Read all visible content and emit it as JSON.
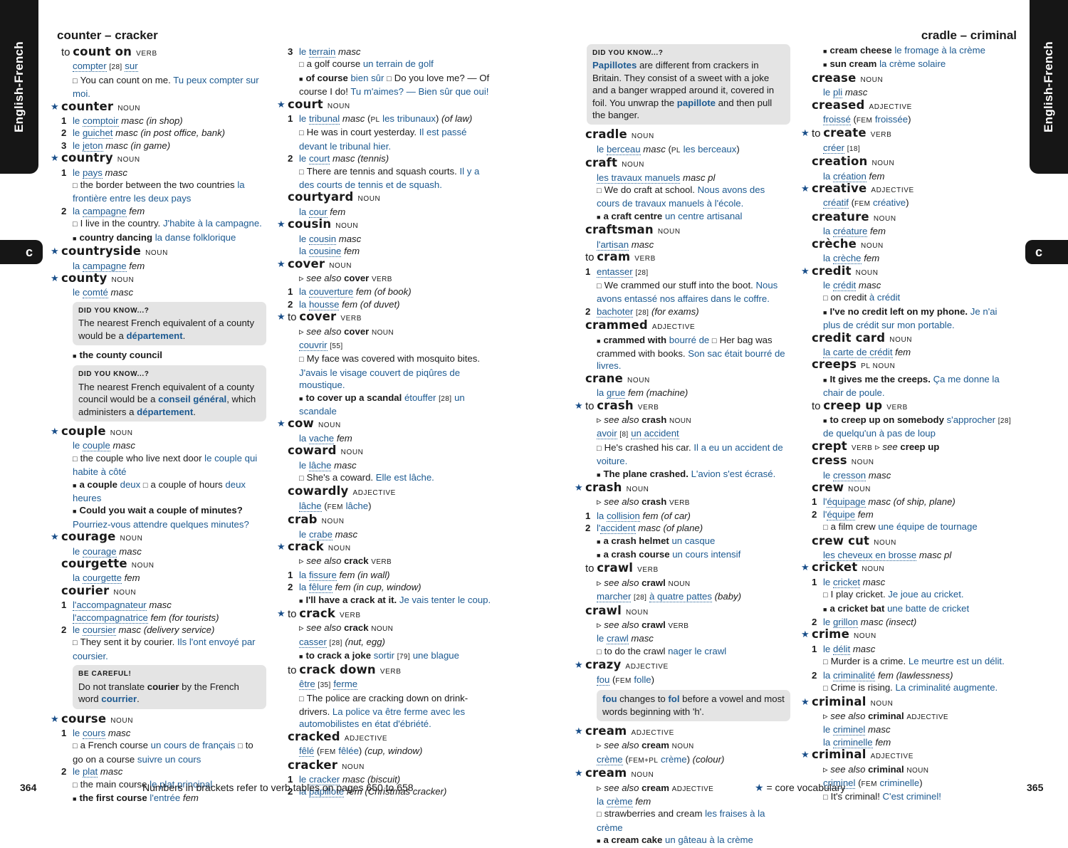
{
  "tabs": {
    "language": "English-French",
    "letter": "c"
  },
  "running_heads": {
    "left": "counter – cracker",
    "right": "cradle – criminal"
  },
  "footer": {
    "left_page_number": "364",
    "left_note": "Numbers in brackets refer to verb tables on pages 650 to 658",
    "right_note": "= core vocabulary",
    "right_note_symbol": "★",
    "right_page_number": "365"
  },
  "col1": {
    "e1": {
      "to": "to",
      "hw": "count on",
      "pos": "verb",
      "t1": "compter",
      "n1": "[28]",
      "t2": "sur",
      "ex_en": "You can count on me.",
      "ex_fr": "Tu peux compter sur moi."
    },
    "e2": {
      "hw": "counter",
      "pos": "noun",
      "s1": {
        "art": "le",
        "w": "comptoir",
        "g": "masc",
        "c": "(in shop)"
      },
      "s2": {
        "art": "le",
        "w": "guichet",
        "g": "masc",
        "c": "(in post office, bank)"
      },
      "s3": {
        "art": "le",
        "w": "jeton",
        "g": "masc",
        "c": "(in game)"
      }
    },
    "e3": {
      "hw": "country",
      "pos": "noun",
      "s1": {
        "art": "le",
        "w": "pays",
        "g": "masc",
        "ex_en": "the border between the two countries",
        "ex_fr": "la frontière entre les deux pays"
      },
      "s2": {
        "art": "la",
        "w": "campagne",
        "g": "fem",
        "ex_en": "I live in the country.",
        "ex_fr": "J'habite à la campagne.",
        "ph_en": "country dancing",
        "ph_fr": "la danse folklorique"
      }
    },
    "e4": {
      "hw": "countryside",
      "pos": "noun",
      "art": "la",
      "w": "campagne",
      "g": "fem"
    },
    "e5": {
      "hw": "county",
      "pos": "noun",
      "art": "le",
      "w": "comté",
      "g": "masc",
      "box1": {
        "label": "Did you know...?",
        "t1": "The nearest French equivalent of a county would be a ",
        "b1": "département",
        "t2": "."
      },
      "ph": "the county council",
      "box2": {
        "label": "Did you know...?",
        "t1": "The nearest French equivalent of a county council would be a ",
        "b1": "conseil général",
        "t2": ", which administers a ",
        "b2": "département",
        "t3": "."
      }
    },
    "e6": {
      "hw": "couple",
      "pos": "noun",
      "art": "le",
      "w": "couple",
      "g": "masc",
      "ex1_en": "the couple who live next door",
      "ex1_fr": "le couple qui habite à côté",
      "ph1_en": "a couple",
      "ph1_fr": "deux",
      "ex2_en": "a couple of hours",
      "ex2_fr": "deux heures",
      "ph2_en": "Could you wait a couple of minutes?",
      "ph2_fr": "Pourriez-vous attendre quelques minutes?"
    },
    "e7": {
      "hw": "courage",
      "pos": "noun",
      "art": "le",
      "w": "courage",
      "g": "masc"
    },
    "e8": {
      "hw": "courgette",
      "pos": "noun",
      "art": "la",
      "w": "courgette",
      "g": "fem"
    },
    "e9": {
      "hw": "courier",
      "pos": "noun",
      "s1": {
        "w1": "l'accompagnateur",
        "g1": "masc",
        "w2": "l'accompagnatrice",
        "g2": "fem",
        "c": "(for tourists)"
      },
      "s2": {
        "art": "le",
        "w": "coursier",
        "g": "masc",
        "c": "(delivery service)",
        "ex_en": "They sent it by courier.",
        "ex_fr": "Ils l'ont envoyé par coursier."
      },
      "box": {
        "label": "Be careful!",
        "t1": "Do not translate ",
        "b1": "courier",
        "t2": " by the French word ",
        "b2": "courrier",
        "t3": "."
      }
    },
    "e10": {
      "hw": "course",
      "pos": "noun",
      "s1": {
        "art": "le",
        "w": "cours",
        "g": "masc",
        "ex1_en": "a French course",
        "ex1_fr": "un cours de français",
        "ex2_en": "to go on a course",
        "ex2_fr": "suivre un cours"
      },
      "s2": {
        "art": "le",
        "w": "plat",
        "g": "masc",
        "ex_en": "the main course",
        "ex_fr": "le plat principal",
        "ph_en": "the first course",
        "ph_fr": "l'entrée",
        "ph_g": "fem"
      }
    }
  },
  "col2": {
    "c1": {
      "art": "le",
      "w": "terrain",
      "g": "masc",
      "ex_en": "a golf course",
      "ex_fr": "un terrain de golf",
      "ph_en": "of course",
      "ph_fr": "bien sûr",
      "ex2_en": "Do you love me? — Of course I do!",
      "ex2_fr": "Tu m'aimes? — Bien sûr que oui!"
    },
    "e1": {
      "hw": "court",
      "pos": "noun",
      "s1": {
        "art": "le",
        "w": "tribunal",
        "g": "masc",
        "pl": "pl",
        "plw": "les tribunaux",
        "c": "(of law)",
        "ex_en": "He was in court yesterday.",
        "ex_fr": "Il est passé devant le tribunal hier."
      },
      "s2": {
        "art": "le",
        "w": "court",
        "g": "masc",
        "c": "(tennis)",
        "ex_en": "There are tennis and squash courts.",
        "ex_fr": "Il y a des courts de tennis et de squash."
      }
    },
    "e2": {
      "hw": "courtyard",
      "pos": "noun",
      "art": "la",
      "w": "cour",
      "g": "fem"
    },
    "e3": {
      "hw": "cousin",
      "pos": "noun",
      "a1": "le",
      "w1": "cousin",
      "g1": "masc",
      "a2": "la",
      "w2": "cousine",
      "g2": "fem"
    },
    "e4": {
      "hw": "cover",
      "pos": "noun",
      "see": "see also",
      "see_hw": "cover",
      "see_pos": "verb",
      "s1": {
        "art": "la",
        "w": "couverture",
        "g": "fem",
        "c": "(of book)"
      },
      "s2": {
        "art": "la",
        "w": "housse",
        "g": "fem",
        "c": "(of duvet)"
      }
    },
    "e5": {
      "to": "to",
      "hw": "cover",
      "pos": "verb",
      "see": "see also",
      "see_hw": "cover",
      "see_pos": "noun",
      "w": "couvrir",
      "n": "[55]",
      "ex_en": "My face was covered with mosquito bites.",
      "ex_fr": "J'avais le visage couvert de piqûres de moustique.",
      "ph_en": "to cover up a scandal",
      "ph_fr1": "étouffer",
      "ph_n": "[28]",
      "ph_fr2": "un scandale"
    },
    "e6": {
      "hw": "cow",
      "pos": "noun",
      "art": "la",
      "w": "vache",
      "g": "fem"
    },
    "e7": {
      "hw": "coward",
      "pos": "noun",
      "art": "le",
      "w": "lâche",
      "g": "masc",
      "ex_en": "She's a coward.",
      "ex_fr": "Elle est lâche."
    },
    "e8": {
      "hw": "cowardly",
      "pos": "adjective",
      "w": "lâche",
      "fem": "fem",
      "fw": "lâche"
    },
    "e9": {
      "hw": "crab",
      "pos": "noun",
      "art": "le",
      "w": "crabe",
      "g": "masc"
    },
    "e10": {
      "hw": "crack",
      "pos": "noun",
      "see": "see also",
      "see_hw": "crack",
      "see_pos": "verb",
      "s1": {
        "art": "la",
        "w": "fissure",
        "g": "fem",
        "c": "(in wall)"
      },
      "s2": {
        "art": "la",
        "w": "fêlure",
        "g": "fem",
        "c": "(in cup, window)",
        "ph_en": "I'll have a crack at it.",
        "ph_fr": "Je vais tenter le coup."
      }
    },
    "e11": {
      "to": "to",
      "hw": "crack",
      "pos": "verb",
      "see": "see also",
      "see_hw": "crack",
      "see_pos": "noun",
      "w": "casser",
      "n": "[28]",
      "c": "(nut, egg)",
      "ph_en": "to crack a joke",
      "ph_fr1": "sortir",
      "ph_n": "[79]",
      "ph_fr2": "une blague"
    },
    "e12": {
      "to": "to",
      "hw": "crack down",
      "pos": "verb",
      "w1": "être",
      "n": "[35]",
      "w2": "ferme",
      "ex_en": "The police are cracking down on drink-drivers.",
      "ex_fr": "La police va être ferme avec les automobilistes en état d'ébriété."
    },
    "e13": {
      "hw": "cracked",
      "pos": "adjective",
      "w": "fêlé",
      "fem": "fem",
      "fw": "fêlée",
      "c": "(cup, window)"
    },
    "e14": {
      "hw": "cracker",
      "pos": "noun",
      "s1": {
        "art": "le",
        "w": "cracker",
        "g": "masc",
        "c": "(biscuit)"
      },
      "s2": {
        "art": "la",
        "w": "papillote",
        "g": "fem",
        "c": "(Christmas cracker)"
      }
    }
  },
  "col3": {
    "box": {
      "label": "Did you know...?",
      "b1": "Papillotes",
      "t1": " are different from crackers in Britain. They consist of a sweet with a joke and a banger wrapped around it, covered in foil. You unwrap the ",
      "b2": "papillote",
      "t2": " and then pull the banger."
    },
    "e1": {
      "hw": "cradle",
      "pos": "noun",
      "art": "le",
      "w": "berceau",
      "g": "masc",
      "pl": "pl",
      "plw": "les berceaux"
    },
    "e2": {
      "hw": "craft",
      "pos": "noun",
      "w": "les travaux manuels",
      "g": "masc pl",
      "ex_en": "We do craft at school.",
      "ex_fr": "Nous avons des cours de travaux manuels à l'école.",
      "ph_en": "a craft centre",
      "ph_fr": "un centre artisanal"
    },
    "e3": {
      "hw": "craftsman",
      "pos": "noun",
      "w": "l'artisan",
      "g": "masc"
    },
    "e4": {
      "to": "to",
      "hw": "cram",
      "pos": "verb",
      "s1": {
        "w": "entasser",
        "n": "[28]",
        "ex_en": "We crammed our stuff into the boot.",
        "ex_fr": "Nous avons entassé nos affaires dans le coffre."
      },
      "s2": {
        "w": "bachoter",
        "n": "[28]",
        "c": "(for exams)"
      }
    },
    "e5": {
      "hw": "crammed",
      "pos": "adjective",
      "ph_en": "crammed with",
      "ph_fr": "bourré de",
      "ex_en": "Her bag was crammed with books.",
      "ex_fr": "Son sac était bourré de livres."
    },
    "e6": {
      "hw": "crane",
      "pos": "noun",
      "art": "la",
      "w": "grue",
      "g": "fem",
      "c": "(machine)"
    },
    "e7": {
      "to": "to",
      "hw": "crash",
      "pos": "verb",
      "see": "see also",
      "see_hw": "crash",
      "see_pos": "noun",
      "w1": "avoir",
      "n": "[8]",
      "w2": "un accident",
      "ex_en": "He's crashed his car.",
      "ex_fr": "Il a eu un accident de voiture.",
      "ph_en": "The plane crashed.",
      "ph_fr": "L'avion s'est écrasé."
    },
    "e8": {
      "hw": "crash",
      "pos": "noun",
      "see": "see also",
      "see_hw": "crash",
      "see_pos": "verb",
      "s1": {
        "art": "la",
        "w": "collision",
        "g": "fem",
        "c": "(of car)"
      },
      "s2": {
        "art": "l'",
        "w": "accident",
        "g": "masc",
        "c": "(of plane)",
        "ph1_en": "a crash helmet",
        "ph1_fr": "un casque",
        "ph2_en": "a crash course",
        "ph2_fr": "un cours intensif"
      }
    },
    "e9": {
      "to": "to",
      "hw": "crawl",
      "pos": "verb",
      "see": "see also",
      "see_hw": "crawl",
      "see_pos": "noun",
      "w1": "marcher",
      "n": "[28]",
      "w2": "à quatre pattes",
      "c": "(baby)"
    },
    "e10": {
      "hw": "crawl",
      "pos": "noun",
      "see": "see also",
      "see_hw": "crawl",
      "see_pos": "verb",
      "art": "le",
      "w": "crawl",
      "g": "masc",
      "ex_en": "to do the crawl",
      "ex_fr": "nager le crawl"
    },
    "e11": {
      "hw": "crazy",
      "pos": "adjective",
      "w": "fou",
      "fem": "fem",
      "fw": "folle",
      "box": {
        "b1": "fou",
        "t1": " changes to ",
        "b2": "fol",
        "t2": " before a vowel and most words beginning with 'h'."
      }
    },
    "e12": {
      "hw": "cream",
      "pos": "adjective",
      "see": "see also",
      "see_hw": "cream",
      "see_pos": "noun",
      "w": "crème",
      "fem": "fem+pl",
      "fw": "crème",
      "c": "(colour)"
    },
    "e13": {
      "hw": "cream",
      "pos": "noun",
      "see": "see also",
      "see_hw": "cream",
      "see_pos": "adjective",
      "art": "la",
      "w": "crème",
      "g": "fem",
      "ex_en": "strawberries and cream",
      "ex_fr": "les fraises à la crème",
      "ph_en": "a cream cake",
      "ph_fr": "un gâteau à la crème"
    }
  },
  "col4": {
    "c1": {
      "ph1_en": "cream cheese",
      "ph1_fr": "le fromage à la crème",
      "ph2_en": "sun cream",
      "ph2_fr": "la crème solaire"
    },
    "e1": {
      "hw": "crease",
      "pos": "noun",
      "art": "le",
      "w": "pli",
      "g": "masc"
    },
    "e2": {
      "hw": "creased",
      "pos": "adjective",
      "w": "froissé",
      "fem": "fem",
      "fw": "froissée"
    },
    "e3": {
      "to": "to",
      "hw": "create",
      "pos": "verb",
      "w": "créer",
      "n": "[18]"
    },
    "e4": {
      "hw": "creation",
      "pos": "noun",
      "art": "la",
      "w": "création",
      "g": "fem"
    },
    "e5": {
      "hw": "creative",
      "pos": "adjective",
      "w": "créatif",
      "fem": "fem",
      "fw": "créative"
    },
    "e6": {
      "hw": "creature",
      "pos": "noun",
      "art": "la",
      "w": "créature",
      "g": "fem"
    },
    "e7": {
      "hw": "crèche",
      "pos": "noun",
      "art": "la",
      "w": "crèche",
      "g": "fem"
    },
    "e8": {
      "hw": "credit",
      "pos": "noun",
      "art": "le",
      "w": "crédit",
      "g": "masc",
      "ex_en": "on credit",
      "ex_fr": "à crédit",
      "ph_en": "I've no credit left on my phone.",
      "ph_fr": "Je n'ai plus de crédit sur mon portable."
    },
    "e9": {
      "hw": "credit card",
      "pos": "noun",
      "w": "la carte de crédit",
      "g": "fem"
    },
    "e10": {
      "hw": "creeps",
      "pos": "pl noun",
      "ph_en": "It gives me the creeps.",
      "ph_fr": "Ça me donne la chair de poule."
    },
    "e11": {
      "to": "to",
      "hw": "creep up",
      "pos": "verb",
      "ph_en": "to creep up on somebody",
      "ph_fr1": "s'approcher",
      "ph_n": "[28]",
      "ph_fr2": "de quelqu'un à pas de loup"
    },
    "e12": {
      "hw": "crept",
      "pos": "verb",
      "see": "see",
      "see_hw": "creep up"
    },
    "e13": {
      "hw": "cress",
      "pos": "noun",
      "art": "le",
      "w": "cresson",
      "g": "masc"
    },
    "e14": {
      "hw": "crew",
      "pos": "noun",
      "s1": {
        "art": "l'",
        "w": "équipage",
        "g": "masc",
        "c": "(of ship, plane)"
      },
      "s2": {
        "art": "l'",
        "w": "équipe",
        "g": "fem",
        "ex_en": "a film crew",
        "ex_fr": "une équipe de tournage"
      }
    },
    "e15": {
      "hw": "crew cut",
      "pos": "noun",
      "w": "les cheveux en brosse",
      "g": "masc pl"
    },
    "e16": {
      "hw": "cricket",
      "pos": "noun",
      "s1": {
        "art": "le",
        "w": "cricket",
        "g": "masc",
        "ex_en": "I play cricket.",
        "ex_fr": "Je joue au cricket.",
        "ph_en": "a cricket bat",
        "ph_fr": "une batte de cricket"
      },
      "s2": {
        "art": "le",
        "w": "grillon",
        "g": "masc",
        "c": "(insect)"
      }
    },
    "e17": {
      "hw": "crime",
      "pos": "noun",
      "s1": {
        "art": "le",
        "w": "délit",
        "g": "masc",
        "ex_en": "Murder is a crime.",
        "ex_fr": "Le meurtre est un délit."
      },
      "s2": {
        "art": "la",
        "w": "criminalité",
        "g": "fem",
        "c": "(lawlessness)",
        "ex_en": "Crime is rising.",
        "ex_fr": "La criminalité augmente."
      }
    },
    "e18": {
      "hw": "criminal",
      "pos": "noun",
      "see": "see also",
      "see_hw": "criminal",
      "see_pos": "adjective",
      "a1": "le",
      "w1": "criminel",
      "g1": "masc",
      "a2": "la",
      "w2": "criminelle",
      "g2": "fem"
    },
    "e19": {
      "hw": "criminal",
      "pos": "adjective",
      "see": "see also",
      "see_hw": "criminal",
      "see_pos": "noun",
      "w": "criminel",
      "fem": "fem",
      "fw": "criminelle",
      "ex_en": "It's criminal!",
      "ex_fr": "C'est criminel!"
    }
  }
}
